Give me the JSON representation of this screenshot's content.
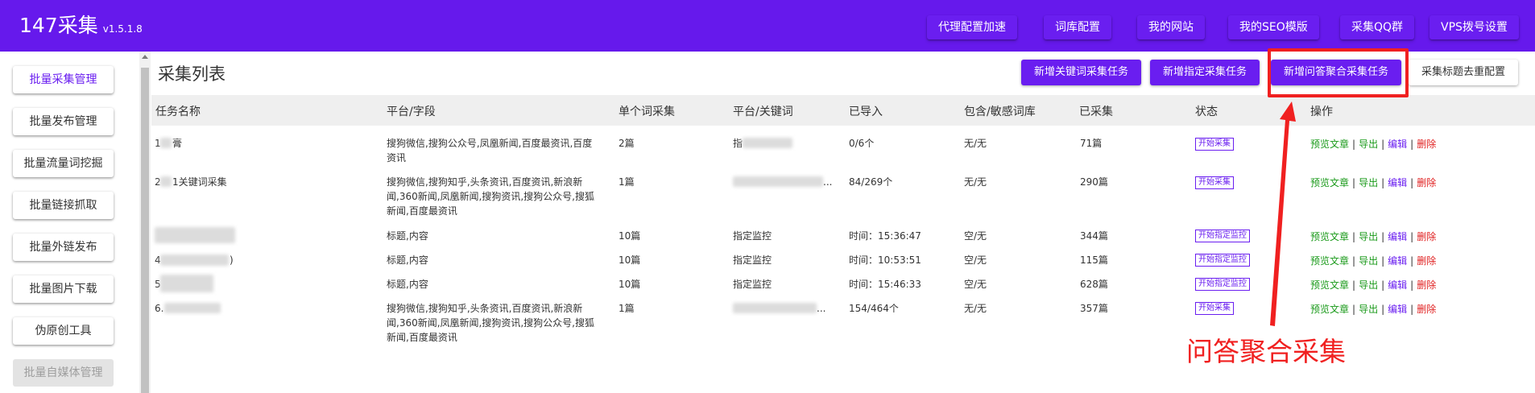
{
  "header": {
    "brand": "147采集",
    "version": "v1.5.1.8",
    "nav": [
      "代理配置加速",
      "词库配置",
      "我的网站",
      "我的SEO模版",
      "采集QQ群",
      "VPS拨号设置"
    ]
  },
  "sidebar": {
    "items": [
      "批量采集管理",
      "批量发布管理",
      "批量流量词挖掘",
      "批量链接抓取",
      "批量外链发布",
      "批量图片下载",
      "伪原创工具",
      "批量自媒体管理"
    ]
  },
  "main": {
    "title": "采集列表",
    "actions": [
      "新增关键词采集任务",
      "新增指定采集任务",
      "新增问答聚合采集任务",
      "采集标题去重配置"
    ],
    "columns": [
      "任务名称",
      "平台/字段",
      "单个词采集",
      "平台/关键词",
      "已导入",
      "包含/敏感词库",
      "已采集",
      "状态",
      "操作"
    ],
    "rows": [
      {
        "name": "1",
        "name_suffix": "膏",
        "platform_1": "搜狗微信,搜狗公众号,凤凰新闻,百度最资讯,百度",
        "platform_2": "资讯",
        "platform_3": "",
        "per_word": "2篇",
        "keyword": "指",
        "imported": "0/6个",
        "filter": "无/无",
        "collected": "71篇",
        "status": "开始采集"
      },
      {
        "name": "2",
        "name_suffix": "1关键词采集",
        "platform_1": "搜狗微信,搜狗知乎,头条资讯,百度资讯,新浪新",
        "platform_2": "闻,360新闻,凤凰新闻,搜狗资讯,搜狗公众号,搜狐",
        "platform_3": "新闻,百度最资讯",
        "per_word": "1篇",
        "keyword": "...",
        "imported": "84/269个",
        "filter": "无/无",
        "collected": "290篇",
        "status": "开始采集"
      },
      {
        "name": "",
        "name_suffix": "",
        "platform_1": "标题,内容",
        "platform_2": "",
        "platform_3": "",
        "per_word": "10篇",
        "keyword": "指定监控",
        "imported": "时间：15:36:47",
        "filter": "空/无",
        "collected": "344篇",
        "status": "开始指定监控"
      },
      {
        "name": "4",
        "name_suffix": ")",
        "platform_1": "标题,内容",
        "platform_2": "",
        "platform_3": "",
        "per_word": "10篇",
        "keyword": "指定监控",
        "imported": "时间：10:53:51",
        "filter": "空/无",
        "collected": "115篇",
        "status": "开始指定监控"
      },
      {
        "name": "5",
        "name_suffix": "",
        "platform_1": "标题,内容",
        "platform_2": "",
        "platform_3": "",
        "per_word": "10篇",
        "keyword": "指定监控",
        "imported": "时间：15:46:33",
        "filter": "空/无",
        "collected": "628篇",
        "status": "开始指定监控"
      },
      {
        "name": "6.",
        "name_suffix": "",
        "platform_1": "搜狗微信,搜狗知乎,头条资讯,百度资讯,新浪新",
        "platform_2": "闻,360新闻,凤凰新闻,搜狗资讯,搜狗公众号,搜狐",
        "platform_3": "新闻,百度最资讯",
        "per_word": "1篇",
        "keyword": "...",
        "imported": "154/464个",
        "filter": "无/无",
        "collected": "357篇",
        "status": "开始采集"
      }
    ],
    "ops": {
      "preview": "预览文章",
      "export": "导出",
      "edit": "编辑",
      "delete": "删除",
      "sep": "|"
    }
  },
  "annotation": {
    "text": "问答聚合采集",
    "color": "#f02020"
  },
  "colors": {
    "brand": "#6619ec",
    "accent": "#6a1ef0",
    "ok": "#1a9a1a",
    "danger": "#e02020"
  }
}
